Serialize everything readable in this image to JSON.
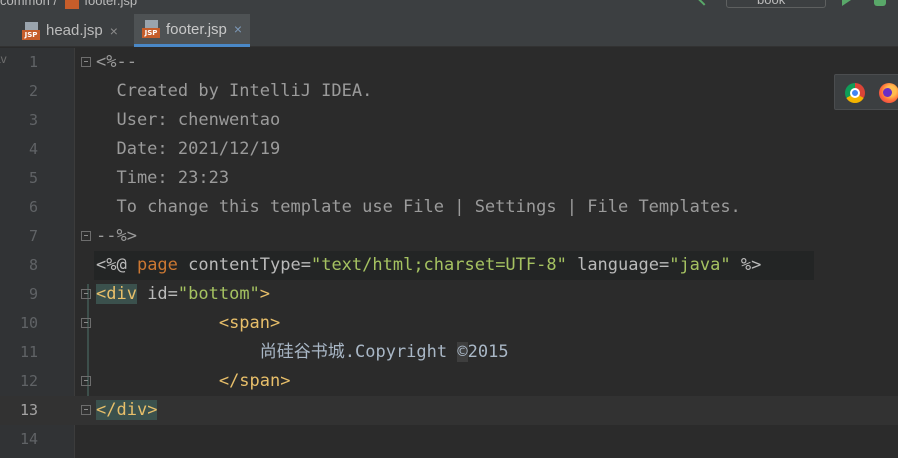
{
  "breadcrumb": {
    "folder": "common",
    "file": "footer.jsp"
  },
  "toolbar": {
    "run_config": "book"
  },
  "tabs": [
    {
      "label": "head.jsp",
      "icon": "jsp-file-icon",
      "active": false
    },
    {
      "label": "footer.jsp",
      "icon": "jsp-file-icon",
      "active": true
    }
  ],
  "close_glyph": "×",
  "file_type_badge": "JSP",
  "left_panel_label": "av",
  "line_numbers": [
    "1",
    "2",
    "3",
    "4",
    "5",
    "6",
    "7",
    "8",
    "9",
    "10",
    "11",
    "12",
    "13",
    "14"
  ],
  "current_line": "13",
  "code": {
    "l1": "<%--",
    "l2": "  Created by IntelliJ IDEA.",
    "l3": "  User: chenwentao",
    "l4": "  Date: 2021/12/19",
    "l5": "  Time: 23:23",
    "l6": "  To change this template use File | Settings | File Templates.",
    "l7": "--%>",
    "l8": {
      "open": "<%@ ",
      "page": "page",
      "attr1": " contentType=",
      "val1": "\"text/html;charset=UTF-8\"",
      "attr2": " language=",
      "val2": "\"java\"",
      "close": " %>"
    },
    "l9": {
      "tag": "<div",
      "attr": " id=",
      "val": "\"bottom\"",
      "end": ">"
    },
    "l10": {
      "indent": "            ",
      "tag": "<span>"
    },
    "l11": {
      "indent": "                ",
      "text": "尚硅谷书城.Copyright ",
      "copy": "©",
      "year": "2015"
    },
    "l12": {
      "indent": "            ",
      "tag": "</span>"
    },
    "l13": {
      "open": "</div",
      "end": ">"
    }
  },
  "browser_popup": {
    "icons": [
      "chrome-icon",
      "firefox-icon"
    ]
  },
  "colors": {
    "background": "#2b2b2b",
    "comment": "#9b9b9b",
    "tag": "#e8bf6a",
    "string": "#a5c261",
    "keyword": "#cc7832",
    "tab_underline": "#4a88c7"
  }
}
